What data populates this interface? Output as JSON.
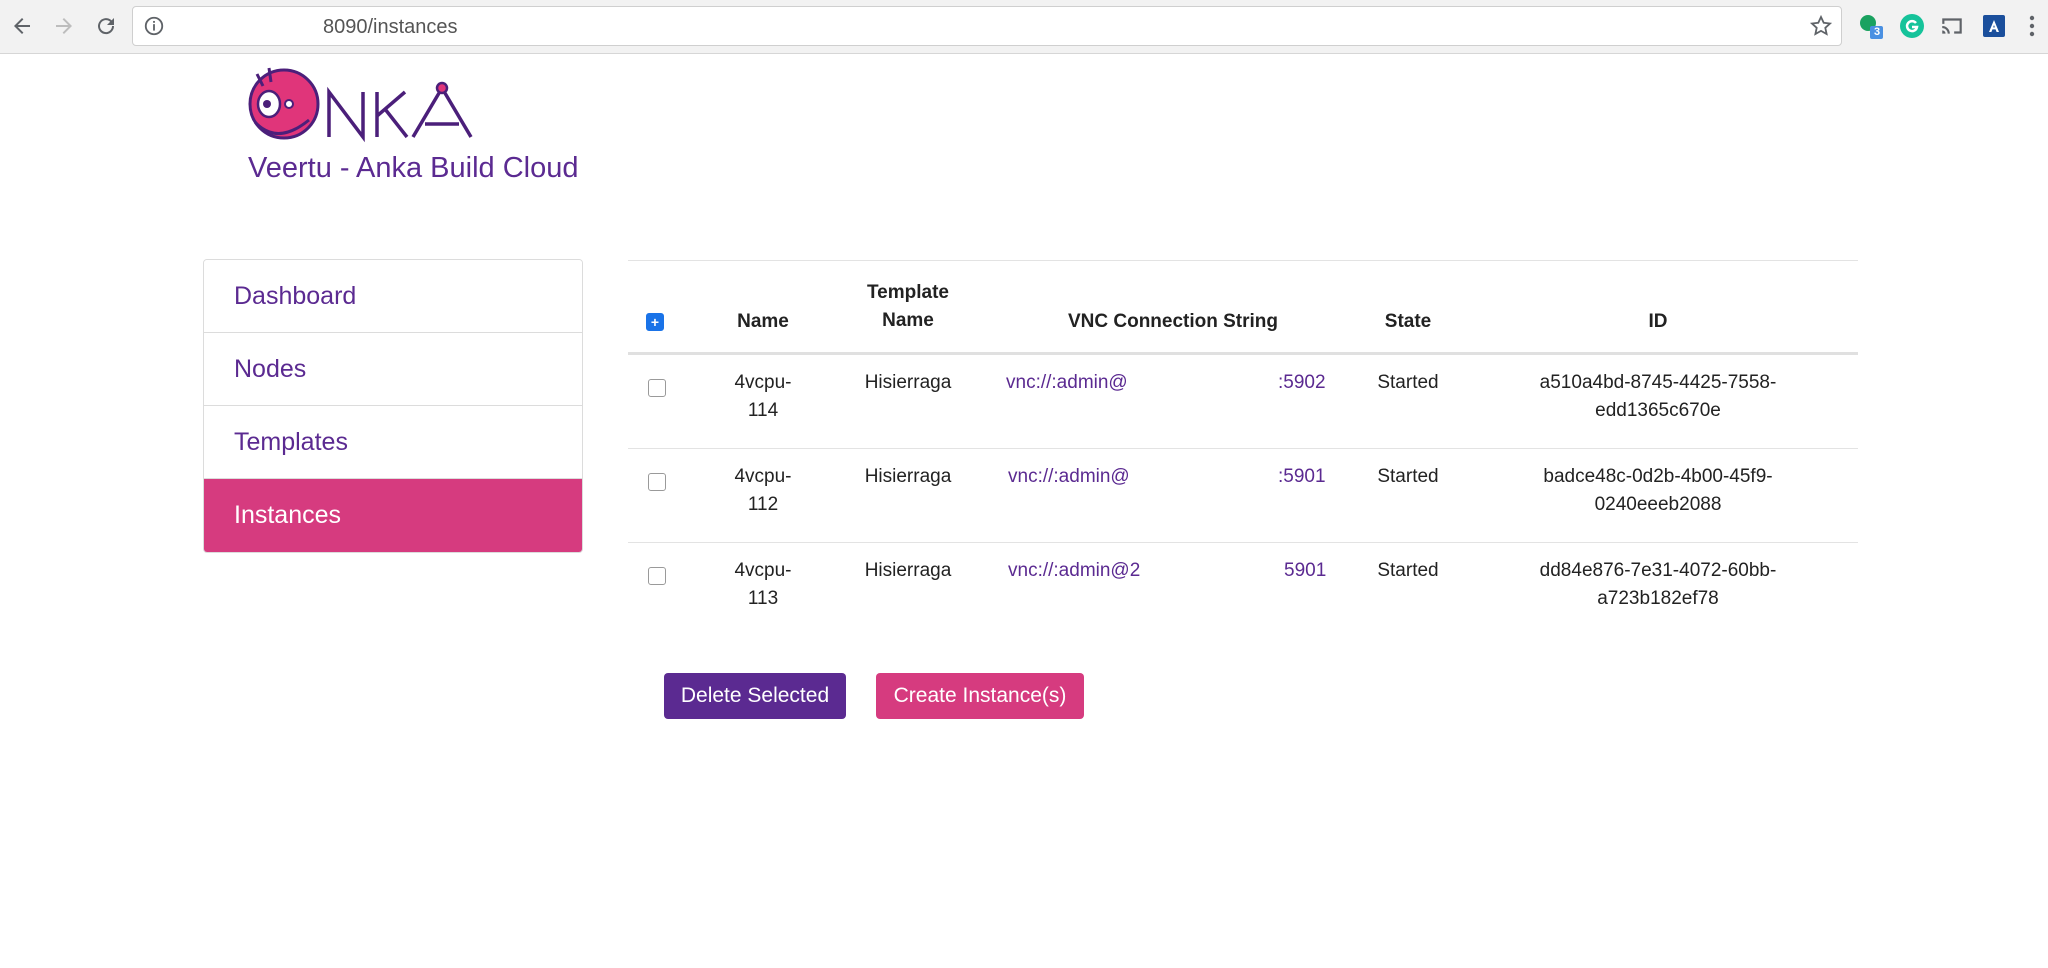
{
  "browser": {
    "url": "8090/instances",
    "extension_badge": "3"
  },
  "brand": {
    "logo_text": "ANKA",
    "title": "Veertu - Anka Build Cloud"
  },
  "sidebar": {
    "items": [
      {
        "label": "Dashboard",
        "active": false
      },
      {
        "label": "Nodes",
        "active": false
      },
      {
        "label": "Templates",
        "active": false
      },
      {
        "label": "Instances",
        "active": true
      }
    ]
  },
  "table": {
    "select_all_symbol": "+",
    "headers": {
      "name": "Name",
      "template_line1": "Template",
      "template_line2": "Name",
      "vnc": "VNC Connection String",
      "state": "State",
      "id": "ID"
    },
    "rows": [
      {
        "name_line1": "4vcpu-",
        "name_line2": "114",
        "template": "Hisierraga",
        "vnc_left": "vnc://:admin@",
        "vnc_right": ":5902",
        "state": "Started",
        "id_line1": "a510a4bd-8745-4425-7558-",
        "id_line2": "edd1365c670e"
      },
      {
        "name_line1": "4vcpu-",
        "name_line2": "112",
        "template": "Hisierraga",
        "vnc_left": "vnc://:admin@",
        "vnc_right": ":5901",
        "state": "Started",
        "id_line1": "badce48c-0d2b-4b00-45f9-",
        "id_line2": "0240eeeb2088"
      },
      {
        "name_line1": "4vcpu-",
        "name_line2": "113",
        "template": "Hisierraga",
        "vnc_left": "vnc://:admin@2",
        "vnc_right": "5901",
        "state": "Started",
        "id_line1": "dd84e876-7e31-4072-60bb-",
        "id_line2": "a723b182ef78"
      }
    ]
  },
  "actions": {
    "delete_label": "Delete Selected",
    "create_label": "Create Instance(s)"
  },
  "colors": {
    "brand_purple": "#5b2a91",
    "brand_pink": "#d63b7f",
    "checkbox_blue": "#1a73e8"
  }
}
